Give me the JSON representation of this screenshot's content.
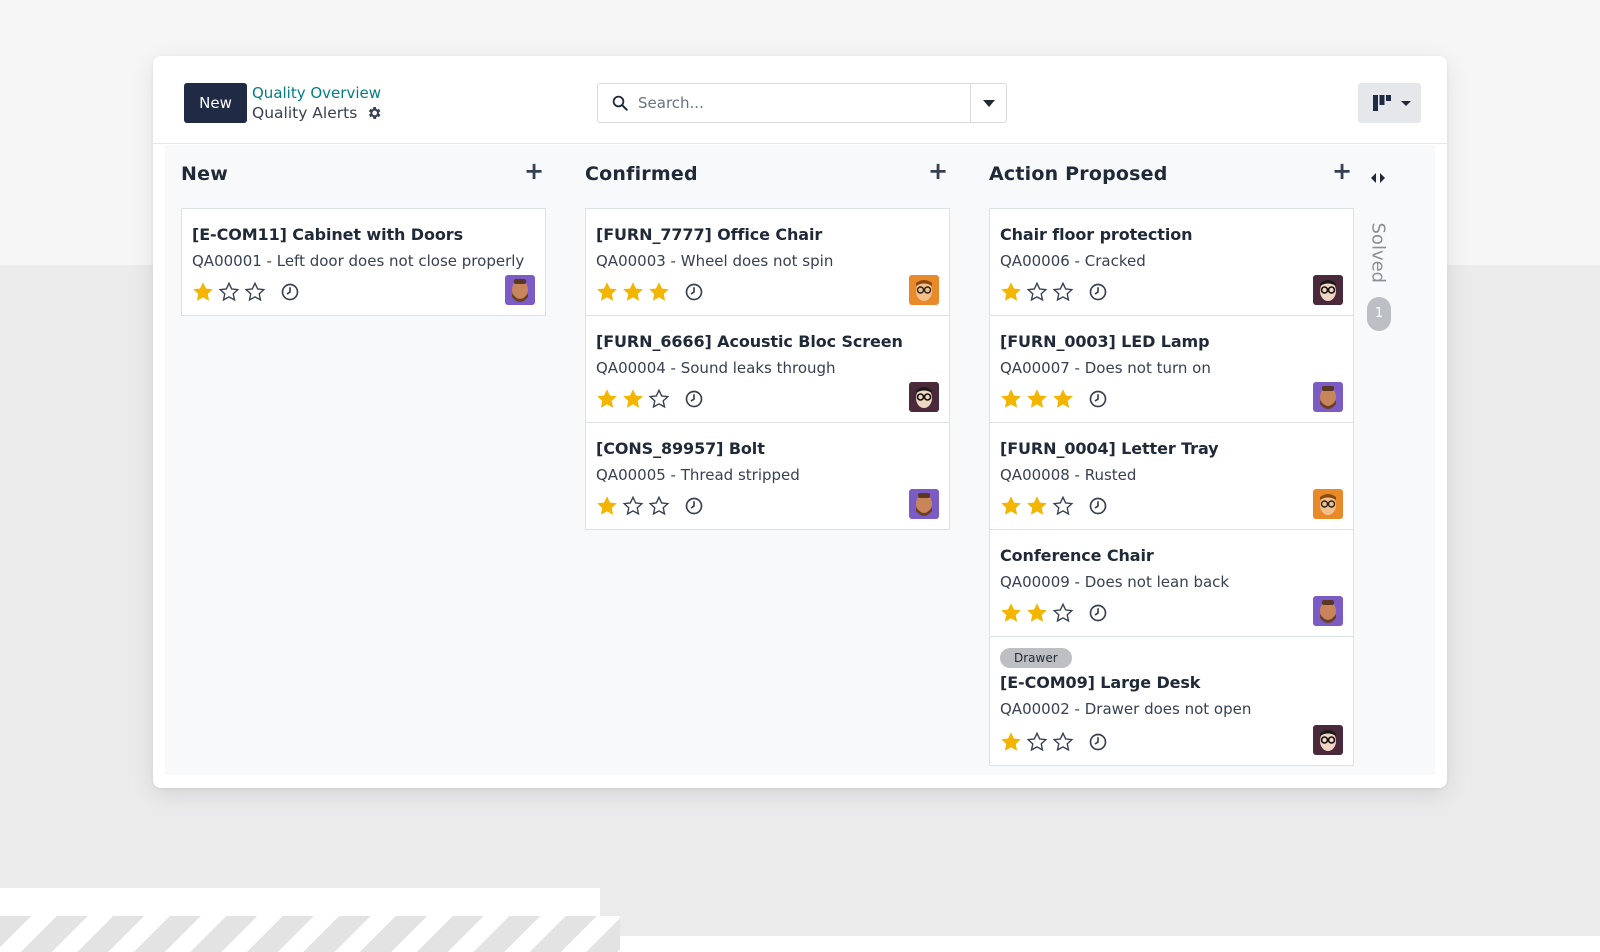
{
  "toolbar": {
    "new_label": "New",
    "breadcrumb_parent": "Quality Overview",
    "breadcrumb_current": "Quality Alerts"
  },
  "search": {
    "placeholder": "Search..."
  },
  "icons": {
    "gear": "gear-icon",
    "search": "search-icon",
    "dropdown": "caret-down-icon",
    "view": "kanban-view-icon",
    "add": "plus-icon",
    "star": "star-icon",
    "activity": "clock-icon",
    "fold": "expand-arrows-icon"
  },
  "colors": {
    "primary": "#1f2a44",
    "link": "#017e84",
    "star": "#f3b500",
    "tag": "#bdbfc3"
  },
  "columns": [
    {
      "title": "New",
      "cards": [
        {
          "title": "[E-COM11] Cabinet with Doors",
          "subtitle": "QA00001 - Left door does not close properly",
          "priority": 1,
          "avatar": "purple-bearded"
        }
      ]
    },
    {
      "title": "Confirmed",
      "cards": [
        {
          "title": "[FURN_7777] Office Chair",
          "subtitle": "QA00003 - Wheel does not spin",
          "priority": 3,
          "avatar": "orange-glasses"
        },
        {
          "title": "[FURN_6666] Acoustic Bloc Screen",
          "subtitle": "QA00004 - Sound leaks through",
          "priority": 2,
          "avatar": "dark-glasses"
        },
        {
          "title": "[CONS_89957] Bolt",
          "subtitle": "QA00005 - Thread stripped",
          "priority": 1,
          "avatar": "purple-bearded"
        }
      ]
    },
    {
      "title": "Action Proposed",
      "cards": [
        {
          "title": "Chair floor protection",
          "subtitle": "QA00006 - Cracked",
          "priority": 1,
          "avatar": "dark-glasses"
        },
        {
          "title": "[FURN_0003] LED Lamp",
          "subtitle": "QA00007 - Does not turn on",
          "priority": 3,
          "avatar": "purple-bearded"
        },
        {
          "title": "[FURN_0004] Letter Tray",
          "subtitle": "QA00008 - Rusted",
          "priority": 2,
          "avatar": "orange-glasses"
        },
        {
          "title": "Conference Chair",
          "subtitle": "QA00009 - Does not lean back",
          "priority": 2,
          "avatar": "purple-bearded"
        },
        {
          "tag": "Drawer",
          "title": "[E-COM09] Large Desk",
          "subtitle": "QA00002 - Drawer does not open",
          "priority": 1,
          "avatar": "dark-glasses"
        }
      ]
    }
  ],
  "folded_column": {
    "title": "Solved",
    "count": "1"
  }
}
